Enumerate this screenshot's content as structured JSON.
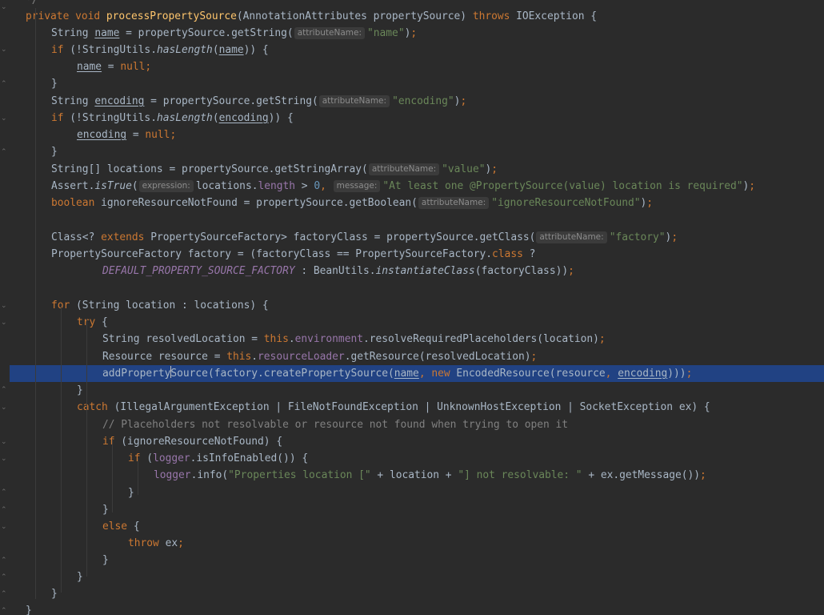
{
  "editor": {
    "lines": [
      [
        {
          "t": "*/",
          "c": "cmt"
        }
      ],
      [
        {
          "t": "private void ",
          "c": "kw"
        },
        {
          "t": "processPropertySource",
          "c": "fn"
        },
        {
          "t": "(AnnotationAttributes propertySource) "
        },
        {
          "t": "throws ",
          "c": "kw"
        },
        {
          "t": "IOException {"
        }
      ],
      [
        {
          "t": "String "
        },
        {
          "t": "name",
          "c": "ul"
        },
        {
          "t": " = propertySource.getString("
        },
        {
          "h": "attributeName:"
        },
        {
          "t": "\"name\"",
          "c": "str"
        },
        {
          "t": ")"
        },
        {
          "t": ";",
          "c": "kw"
        }
      ],
      [
        {
          "t": "if ",
          "c": "kw"
        },
        {
          "t": "(!StringUtils."
        },
        {
          "t": "hasLength",
          "c": "it"
        },
        {
          "t": "("
        },
        {
          "t": "name",
          "c": "ul"
        },
        {
          "t": ")) {"
        }
      ],
      [
        {
          "t": "name",
          "c": "ul"
        },
        {
          "t": " = "
        },
        {
          "t": "null",
          "c": "kw"
        },
        {
          "t": ";",
          "c": "kw"
        }
      ],
      [
        {
          "t": "}"
        }
      ],
      [
        {
          "t": "String "
        },
        {
          "t": "encoding",
          "c": "ul"
        },
        {
          "t": " = propertySource.getString("
        },
        {
          "h": "attributeName:"
        },
        {
          "t": "\"encoding\"",
          "c": "str"
        },
        {
          "t": ")"
        },
        {
          "t": ";",
          "c": "kw"
        }
      ],
      [
        {
          "t": "if ",
          "c": "kw"
        },
        {
          "t": "(!StringUtils."
        },
        {
          "t": "hasLength",
          "c": "it"
        },
        {
          "t": "("
        },
        {
          "t": "encoding",
          "c": "ul"
        },
        {
          "t": ")) {"
        }
      ],
      [
        {
          "t": "encoding",
          "c": "ul"
        },
        {
          "t": " = "
        },
        {
          "t": "null",
          "c": "kw"
        },
        {
          "t": ";",
          "c": "kw"
        }
      ],
      [
        {
          "t": "}"
        }
      ],
      [
        {
          "t": "String[] locations = propertySource.getStringArray("
        },
        {
          "h": "attributeName:"
        },
        {
          "t": "\"value\"",
          "c": "str"
        },
        {
          "t": ")"
        },
        {
          "t": ";",
          "c": "kw"
        }
      ],
      [
        {
          "t": "Assert."
        },
        {
          "t": "isTrue",
          "c": "it"
        },
        {
          "t": "("
        },
        {
          "h": "expression:"
        },
        {
          "t": "locations."
        },
        {
          "t": "length",
          "c": "fld"
        },
        {
          "t": " > "
        },
        {
          "t": "0",
          "c": "num"
        },
        {
          "t": ", ",
          "c": "kw"
        },
        {
          "h": "message:"
        },
        {
          "t": "\"At least one @PropertySource(value) location is required\"",
          "c": "str"
        },
        {
          "t": ")"
        },
        {
          "t": ";",
          "c": "kw"
        }
      ],
      [
        {
          "t": "boolean ",
          "c": "kw"
        },
        {
          "t": "ignoreResourceNotFound = propertySource.getBoolean("
        },
        {
          "h": "attributeName:"
        },
        {
          "t": "\"ignoreResourceNotFound\"",
          "c": "str"
        },
        {
          "t": ")"
        },
        {
          "t": ";",
          "c": "kw"
        }
      ],
      [],
      [
        {
          "t": "Class<? "
        },
        {
          "t": "extends ",
          "c": "kw"
        },
        {
          "t": "PropertySourceFactory> factoryClass = propertySource.getClass("
        },
        {
          "h": "attributeName:"
        },
        {
          "t": "\"factory\"",
          "c": "str"
        },
        {
          "t": ")"
        },
        {
          "t": ";",
          "c": "kw"
        }
      ],
      [
        {
          "t": "PropertySourceFactory factory = (factoryClass == PropertySourceFactory."
        },
        {
          "t": "class ",
          "c": "kw"
        },
        {
          "t": "?"
        }
      ],
      [
        {
          "t": "DEFAULT_PROPERTY_SOURCE_FACTORY",
          "c": "cst"
        },
        {
          "t": " : BeanUtils."
        },
        {
          "t": "instantiateClass",
          "c": "it"
        },
        {
          "t": "(factoryClass))"
        },
        {
          "t": ";",
          "c": "kw"
        }
      ],
      [],
      [
        {
          "t": "for ",
          "c": "kw"
        },
        {
          "t": "(String location : locations) {"
        }
      ],
      [
        {
          "t": "try ",
          "c": "kw"
        },
        {
          "t": "{"
        }
      ],
      [
        {
          "t": "String resolvedLocation = "
        },
        {
          "t": "this",
          "c": "kw"
        },
        {
          "t": "."
        },
        {
          "t": "environment",
          "c": "fld"
        },
        {
          "t": ".resolveRequiredPlaceholders(location)"
        },
        {
          "t": ";",
          "c": "kw"
        }
      ],
      [
        {
          "t": "Resource resource = "
        },
        {
          "t": "this",
          "c": "kw"
        },
        {
          "t": "."
        },
        {
          "t": "resourceLoader",
          "c": "fld"
        },
        {
          "t": ".getResource(resolvedLocation)"
        },
        {
          "t": ";",
          "c": "kw"
        }
      ],
      [
        {
          "t": "addProperty"
        },
        {
          "caret": true
        },
        {
          "t": "Source(factory.createPropertySource("
        },
        {
          "t": "name",
          "c": "ul"
        },
        {
          "t": ", ",
          "c": "kw"
        },
        {
          "t": "new ",
          "c": "kw"
        },
        {
          "t": "EncodedResource(resource"
        },
        {
          "t": ", ",
          "c": "kw"
        },
        {
          "t": "encoding",
          "c": "ul"
        },
        {
          "t": ")))"
        },
        {
          "t": ";",
          "c": "kw"
        }
      ],
      [
        {
          "t": "}"
        }
      ],
      [
        {
          "t": "catch ",
          "c": "kw"
        },
        {
          "t": "(IllegalArgumentException | FileNotFoundException | UnknownHostException | SocketException ex) {"
        }
      ],
      [
        {
          "t": "// Placeholders not resolvable or resource not found when trying to open it",
          "c": "cmt"
        }
      ],
      [
        {
          "t": "if ",
          "c": "kw"
        },
        {
          "t": "(ignoreResourceNotFound) {"
        }
      ],
      [
        {
          "t": "if ",
          "c": "kw"
        },
        {
          "t": "("
        },
        {
          "t": "logger",
          "c": "fld"
        },
        {
          "t": ".isInfoEnabled()) {"
        }
      ],
      [
        {
          "t": "logger",
          "c": "fld"
        },
        {
          "t": ".info("
        },
        {
          "t": "\"Properties location [\" ",
          "c": "str"
        },
        {
          "t": "+ location + "
        },
        {
          "t": "\"] not resolvable: \" ",
          "c": "str"
        },
        {
          "t": "+ ex.getMessage())"
        },
        {
          "t": ";",
          "c": "kw"
        }
      ],
      [
        {
          "t": "}"
        }
      ],
      [
        {
          "t": "}"
        }
      ],
      [
        {
          "t": "else ",
          "c": "kw"
        },
        {
          "t": "{"
        }
      ],
      [
        {
          "t": "throw ",
          "c": "kw"
        },
        {
          "t": "ex"
        },
        {
          "t": ";",
          "c": "kw"
        }
      ],
      [
        {
          "t": "}"
        }
      ],
      [
        {
          "t": "}"
        }
      ],
      [
        {
          "t": "}"
        }
      ],
      [
        {
          "t": "}"
        }
      ]
    ],
    "colors": {
      "background": "#2b2b2b",
      "keyword": "#cc7832",
      "method": "#ffc66d",
      "string": "#6a8759",
      "field": "#9876aa",
      "comment": "#808080",
      "number": "#6897bb",
      "selection": "#214283"
    }
  }
}
